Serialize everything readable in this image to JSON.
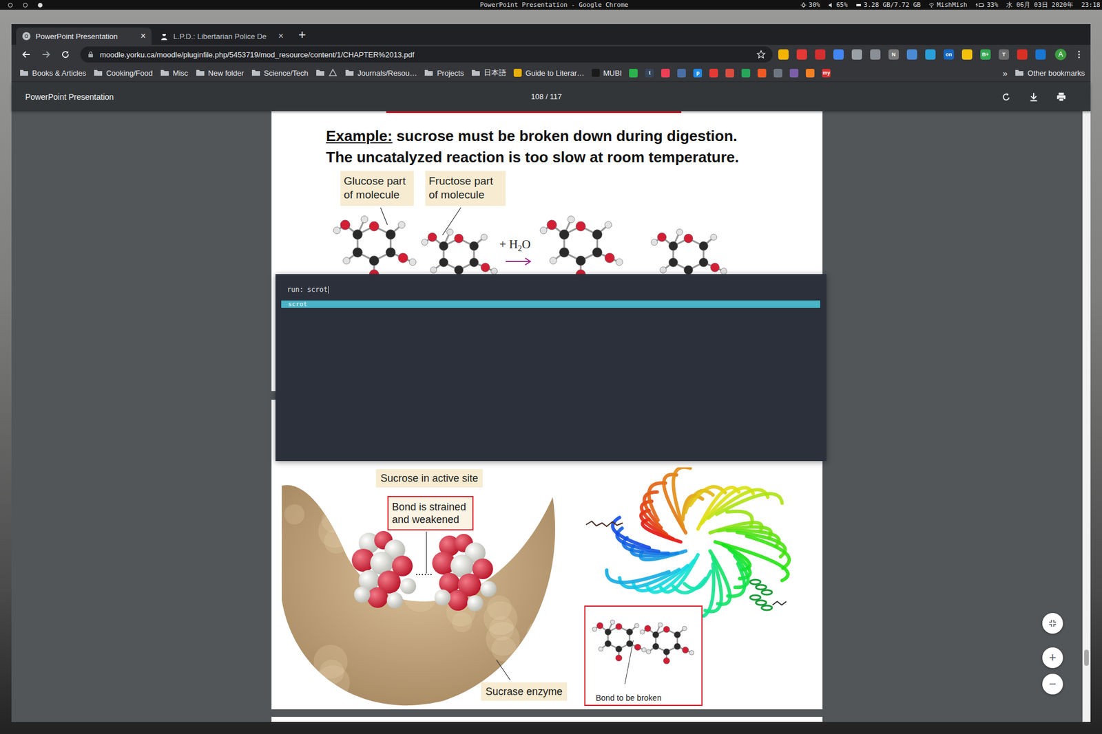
{
  "system_bar": {
    "title": "PowerPoint Presentation - Google Chrome",
    "brightness": "30%",
    "volume": "65%",
    "memory": "3.28 GB/7.72 GB",
    "wifi": "MishMish",
    "battery": "33%",
    "date": "水 06月 03日 2020年",
    "time": "23:18"
  },
  "browser": {
    "tabs": [
      {
        "label": "PowerPoint Presentation",
        "selected": true,
        "close": "×"
      },
      {
        "label": "L.P.D.: Libertarian Police De",
        "selected": false,
        "close": "×"
      }
    ],
    "new_tab": "+",
    "url": "moodle.yorku.ca/moodle/pluginfile.php/5453719/mod_resource/content/1/CHAPTER%2013.pdf",
    "extensions": [
      {
        "color": "#f4b400"
      },
      {
        "color": "#e53935"
      },
      {
        "color": "#d32f2f"
      },
      {
        "color": "#4285f4"
      },
      {
        "color": "#9aa0a6"
      },
      {
        "color": "#8a8f96"
      },
      {
        "color": "#7a7a7a",
        "text": "N"
      },
      {
        "color": "#4a8bd4"
      },
      {
        "color": "#29a0da"
      },
      {
        "color": "#1565c0",
        "text": "on"
      },
      {
        "color": "#f4c20d"
      },
      {
        "color": "#34a853",
        "text": "B+"
      },
      {
        "color": "#6b6b6b",
        "text": "T"
      },
      {
        "color": "#d93025"
      },
      {
        "color": "#1976d2"
      }
    ],
    "avatar": "A",
    "bookmarks": [
      {
        "kind": "folder",
        "label": "Books & Articles"
      },
      {
        "kind": "folder",
        "label": "Cooking/Food"
      },
      {
        "kind": "folder",
        "label": "Misc"
      },
      {
        "kind": "folder",
        "label": "New folder"
      },
      {
        "kind": "folder",
        "label": "Science/Tech"
      },
      {
        "kind": "folder-icon"
      },
      {
        "kind": "folder",
        "label": "Journals/Resou…"
      },
      {
        "kind": "folder",
        "label": "Projects"
      },
      {
        "kind": "folder",
        "label": "日本語"
      },
      {
        "kind": "link",
        "label": "Guide to Literar…",
        "color": "#e8b00c"
      },
      {
        "kind": "link",
        "label": "MUBI",
        "color": "#1a1a1a"
      }
    ],
    "bookmark_icons": [
      {
        "color": "#2bb24c"
      },
      {
        "color": "#35465c",
        "text": "t"
      },
      {
        "color": "#ef3f56"
      },
      {
        "color": "#4a6fa5"
      },
      {
        "color": "#1e88e5",
        "text": "p"
      },
      {
        "color": "#e53935"
      },
      {
        "color": "#db4c3f"
      },
      {
        "color": "#26a65b"
      },
      {
        "color": "#f15a24"
      },
      {
        "color": "#6e7681"
      },
      {
        "color": "#7b5ea7"
      },
      {
        "color": "#f48024"
      },
      {
        "color": "#d32f2f",
        "text": "my"
      }
    ],
    "more_bookmarks": "»",
    "other_bookmarks": "Other bookmarks"
  },
  "pdf_viewer": {
    "title": "PowerPoint Presentation",
    "page": "108 / 117",
    "zoom_in": "+",
    "zoom_out": "−"
  },
  "slide1": {
    "heading_label": "Example:",
    "heading_rest": "sucrose must be broken down during digestion.",
    "heading_line2": "The uncatalyzed reaction is too slow at room temperature.",
    "labels": [
      "Glucose part of molecule",
      "Fructose part of molecule"
    ],
    "reagent": {
      "plus": "+ H",
      "sub": "2",
      "rest": "O"
    }
  },
  "slide2": {
    "active_site": "Sucrose in active site",
    "strained": "Bond is strained and weakened",
    "enzyme": "Sucrase enzyme",
    "bond": "Bond to be broken"
  },
  "launcher": {
    "prompt": "run:",
    "input": "scrot",
    "results": [
      {
        "label": "scrot",
        "selected": true
      }
    ]
  }
}
